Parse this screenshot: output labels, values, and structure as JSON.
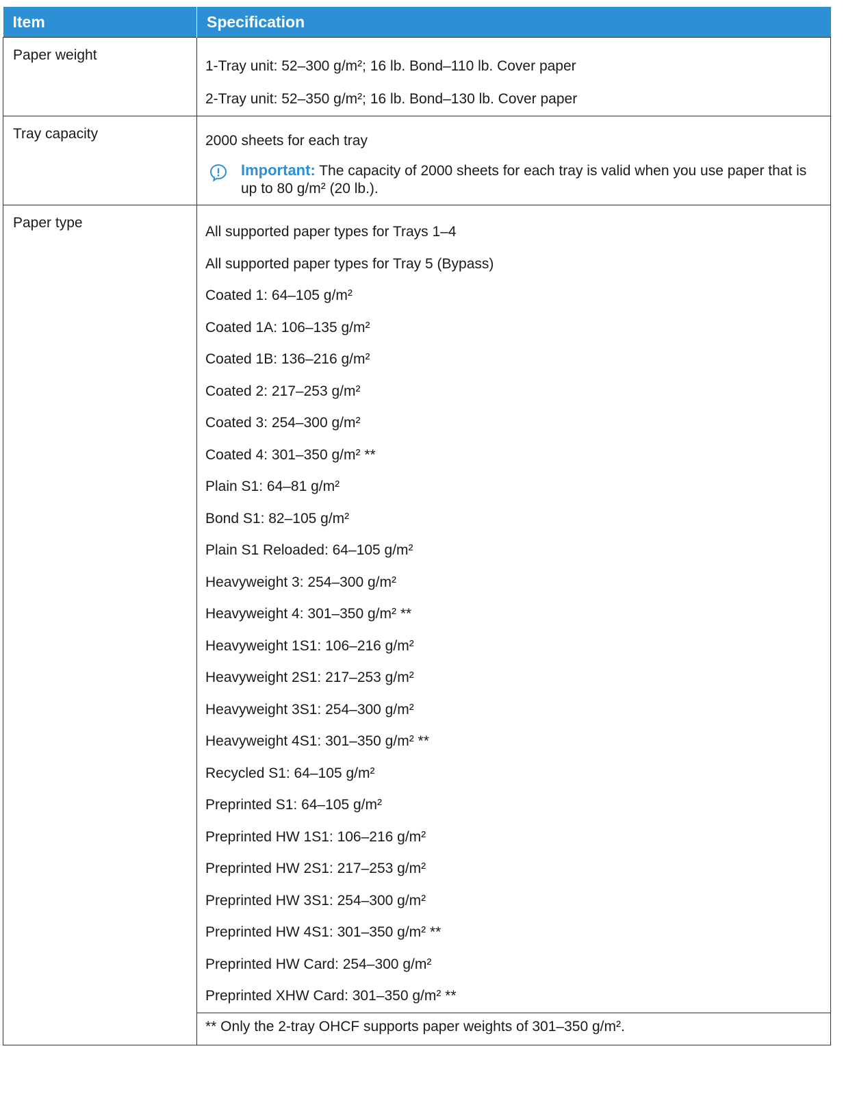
{
  "table": {
    "headers": {
      "item": "Item",
      "specification": "Specification"
    },
    "rows": {
      "paper_weight": {
        "item": "Paper weight",
        "lines": [
          "1-Tray unit: 52–300 g/m²; 16 lb. Bond–110 lb. Cover paper",
          "2-Tray unit: 52–350 g/m²; 16 lb. Bond–130 lb. Cover paper"
        ]
      },
      "tray_capacity": {
        "item": "Tray capacity",
        "line": "2000 sheets for each tray",
        "important_label": "Important:",
        "important_text": "The capacity of 2000 sheets for each tray is valid when you use paper that is up to 80 g/m² (20 lb.)."
      },
      "paper_type": {
        "item": "Paper type",
        "lines": [
          "All supported paper types for Trays 1–4",
          "All supported paper types for Tray 5 (Bypass)",
          "Coated 1: 64–105 g/m²",
          "Coated 1A: 106–135 g/m²",
          "Coated 1B: 136–216 g/m²",
          "Coated 2: 217–253 g/m²",
          "Coated 3: 254–300 g/m²",
          "Coated 4: 301–350 g/m² **",
          "Plain S1: 64–81 g/m²",
          "Bond S1: 82–105 g/m²",
          "Plain S1 Reloaded: 64–105 g/m²",
          "Heavyweight 3: 254–300 g/m²",
          "Heavyweight 4: 301–350 g/m² **",
          "Heavyweight 1S1: 106–216 g/m²",
          "Heavyweight 2S1: 217–253 g/m²",
          "Heavyweight 3S1: 254–300 g/m²",
          "Heavyweight 4S1: 301–350 g/m² **",
          "Recycled S1: 64–105 g/m²",
          "Preprinted S1: 64–105 g/m²",
          "Preprinted HW 1S1: 106–216 g/m²",
          "Preprinted HW 2S1: 217–253 g/m²",
          "Preprinted HW 3S1: 254–300 g/m²",
          "Preprinted HW 4S1: 301–350 g/m² **",
          "Preprinted HW Card: 254–300 g/m²",
          "Preprinted XHW Card: 301–350 g/m² **"
        ],
        "footnote": "** Only the 2-tray OHCF supports paper weights of 301–350 g/m²."
      }
    }
  },
  "colors": {
    "header_bg": "#2d8fd4",
    "accent": "#2d8fd4",
    "border": "#333333"
  }
}
